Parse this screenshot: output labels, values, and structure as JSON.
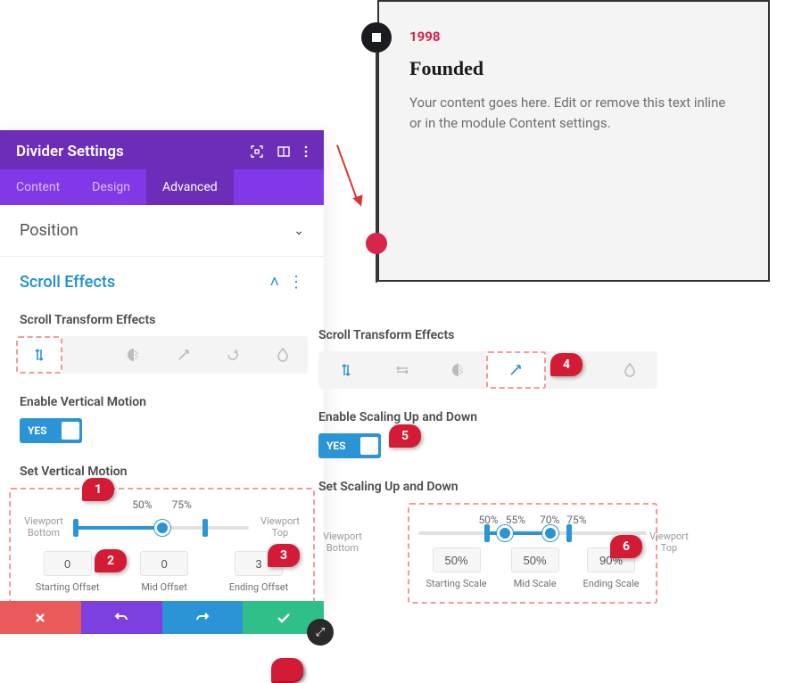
{
  "preview": {
    "year": "1998",
    "title": "Founded",
    "body": "Your content goes here. Edit or remove this text inline or in the module Content settings."
  },
  "modal": {
    "title": "Divider Settings",
    "tabs": {
      "content": "Content",
      "design": "Design",
      "advanced": "Advanced"
    },
    "sections": {
      "position": "Position",
      "scroll_effects": "Scroll Effects"
    }
  },
  "left": {
    "effects_label": "Scroll Transform Effects",
    "enable_label": "Enable Vertical Motion",
    "toggle": "YES",
    "set_label": "Set Vertical Motion",
    "slider": {
      "top_labels": [
        "50%",
        "75%"
      ],
      "vp_bottom": "Viewport Bottom",
      "vp_top": "Viewport Top",
      "offsets": [
        {
          "val": "0",
          "cap": "Starting Offset"
        },
        {
          "val": "0",
          "cap": "Mid Offset"
        },
        {
          "val": "3",
          "cap": "Ending Offset"
        }
      ]
    }
  },
  "right": {
    "effects_label": "Scroll Transform Effects",
    "enable_label": "Enable Scaling Up and Down",
    "toggle": "YES",
    "set_label": "Set Scaling Up and Down",
    "slider": {
      "top_labels": [
        "50%",
        "55%",
        "70%",
        "75%"
      ],
      "vp_bottom": "Viewport Bottom",
      "vp_top": "Viewport Top",
      "offsets": [
        {
          "val": "50%",
          "cap": "Starting Scale"
        },
        {
          "val": "50%",
          "cap": "Mid Scale"
        },
        {
          "val": "90%",
          "cap": "Ending Scale"
        }
      ]
    }
  },
  "badges": {
    "1": "1",
    "2": "2",
    "3": "3",
    "4": "4",
    "5": "5",
    "6": "6"
  }
}
